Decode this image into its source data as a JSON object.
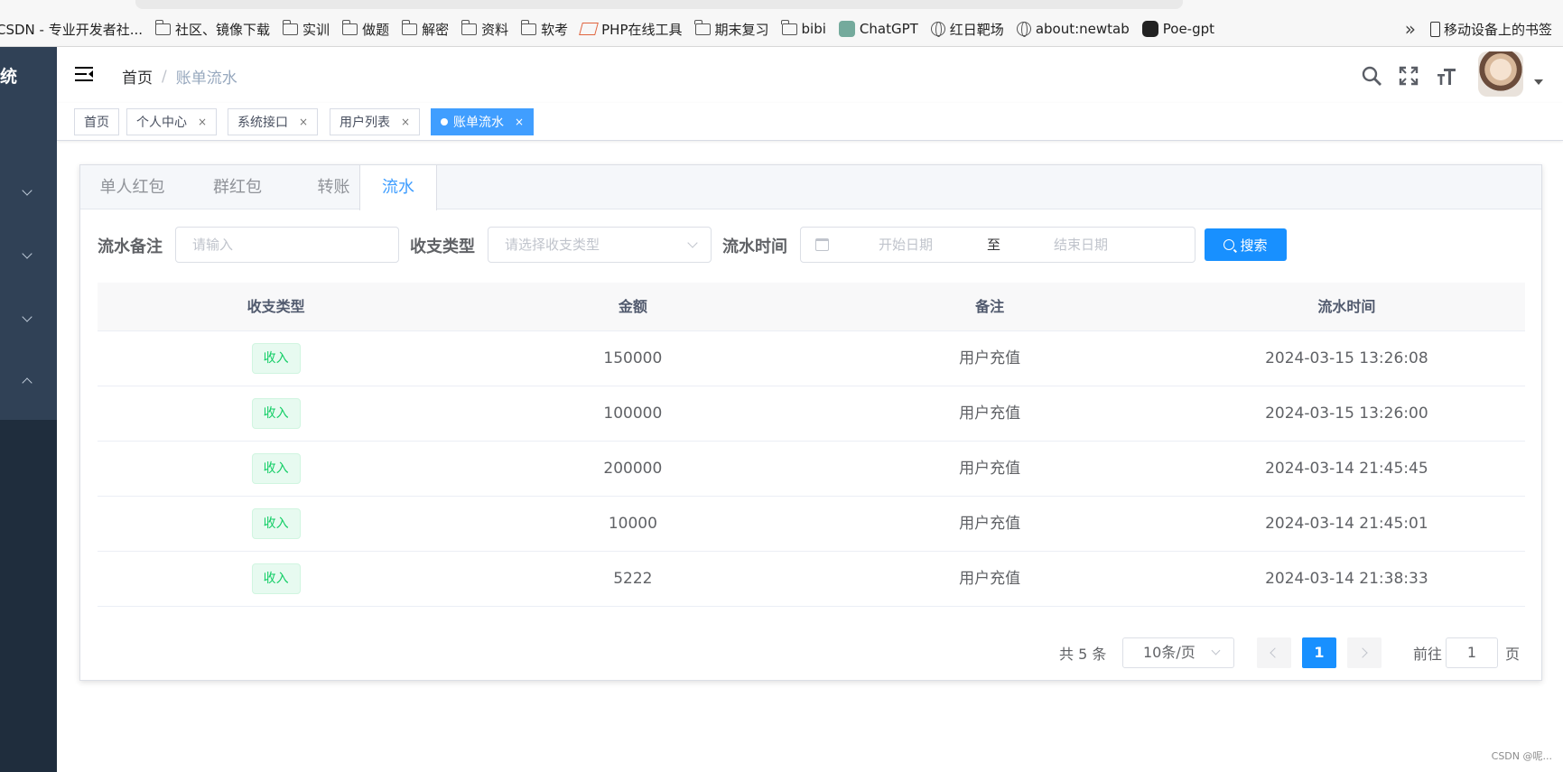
{
  "browser": {
    "bookmarks": [
      {
        "label": "CSDN - 专业开发者社...",
        "icon": "none"
      },
      {
        "label": "社区、镜像下载",
        "icon": "folder-icon"
      },
      {
        "label": "实训",
        "icon": "folder-icon"
      },
      {
        "label": "做题",
        "icon": "folder-icon"
      },
      {
        "label": "解密",
        "icon": "folder-icon"
      },
      {
        "label": "资料",
        "icon": "folder-icon"
      },
      {
        "label": "软考",
        "icon": "folder-icon"
      },
      {
        "label": "PHP在线工具",
        "icon": "php-icon"
      },
      {
        "label": "期末复习",
        "icon": "folder-icon"
      },
      {
        "label": "bibi",
        "icon": "folder-icon"
      },
      {
        "label": "ChatGPT",
        "icon": "chatgpt-icon"
      },
      {
        "label": "红日靶场",
        "icon": "globe-icon"
      },
      {
        "label": "about:newtab",
        "icon": "globe-icon"
      },
      {
        "label": "Poe-gpt",
        "icon": "poe-icon"
      }
    ],
    "more_label": "»",
    "mobile_bookmarks": "移动设备上的书签"
  },
  "sidebar": {
    "title_fragment": "统"
  },
  "navbar": {
    "breadcrumb_home": "首页",
    "breadcrumb_sep": "/",
    "breadcrumb_current": "账单流水"
  },
  "tags": [
    {
      "label": "首页",
      "closable": false,
      "active": false
    },
    {
      "label": "个人中心",
      "closable": true,
      "active": false
    },
    {
      "label": "系统接口",
      "closable": true,
      "active": false
    },
    {
      "label": "用户列表",
      "closable": true,
      "active": false
    },
    {
      "label": "账单流水",
      "closable": true,
      "active": true
    }
  ],
  "close_glyph": "×",
  "tabs": [
    "单人红包",
    "群红包",
    "转账",
    "流水"
  ],
  "active_tab": "流水",
  "form": {
    "remark_label": "流水备注",
    "remark_placeholder": "请输入",
    "type_label": "收支类型",
    "type_placeholder": "请选择收支类型",
    "time_label": "流水时间",
    "start_placeholder": "开始日期",
    "range_sep": "至",
    "end_placeholder": "结束日期",
    "search_label": "搜索"
  },
  "table": {
    "columns": [
      "收支类型",
      "金额",
      "备注",
      "流水时间"
    ],
    "rows": [
      {
        "type": "收入",
        "amount": "150000",
        "remark": "用户充值",
        "time": "2024-03-15 13:26:08"
      },
      {
        "type": "收入",
        "amount": "100000",
        "remark": "用户充值",
        "time": "2024-03-15 13:26:00"
      },
      {
        "type": "收入",
        "amount": "200000",
        "remark": "用户充值",
        "time": "2024-03-14 21:45:45"
      },
      {
        "type": "收入",
        "amount": "10000",
        "remark": "用户充值",
        "time": "2024-03-14 21:45:01"
      },
      {
        "type": "收入",
        "amount": "5222",
        "remark": "用户充值",
        "time": "2024-03-14 21:38:33"
      }
    ]
  },
  "pagination": {
    "total_text": "共 5 条",
    "page_size": "10条/页",
    "current_page": "1",
    "goto_label": "前往",
    "goto_value": "1",
    "page_suffix": "页"
  },
  "watermark": "CSDN @呢...",
  "colors": {
    "sidebar": "#304156",
    "primary": "#1890ff",
    "income_tag": "#13ce66"
  }
}
